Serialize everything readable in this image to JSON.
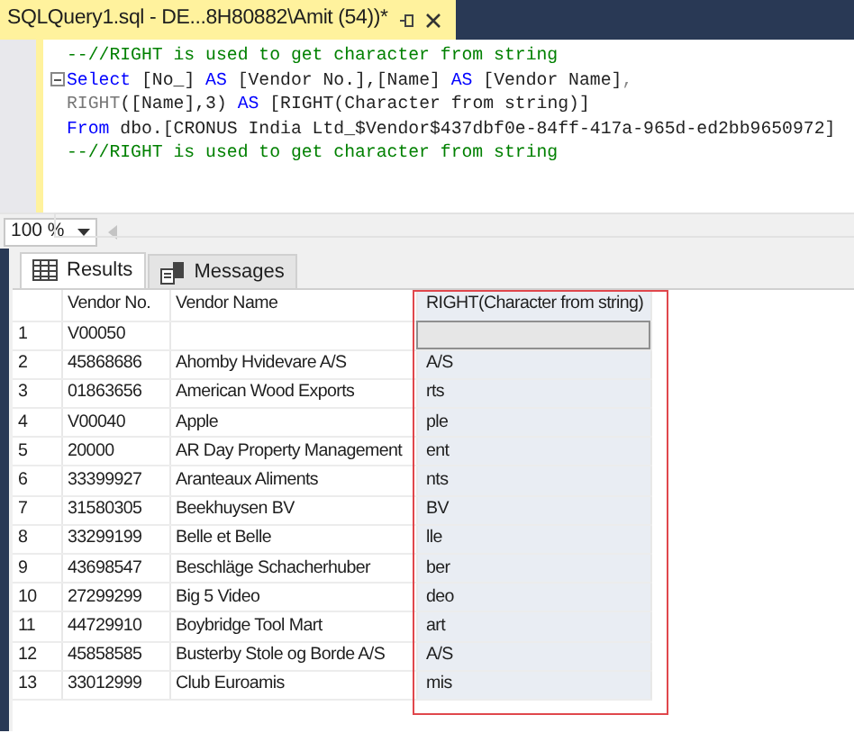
{
  "document_tab": {
    "title": "SQLQuery1.sql - DE...8H80882\\Amit (54))*",
    "selected": true
  },
  "editor": {
    "lines": [
      {
        "fold": false,
        "tokens": [
          {
            "kind": "comment",
            "text": "--//RIGHT is used to get character from string"
          }
        ]
      },
      {
        "fold": true,
        "tokens": [
          {
            "kind": "keyword",
            "text": "Select"
          },
          {
            "kind": "plain",
            "text": " [No_] "
          },
          {
            "kind": "keyword",
            "text": "AS"
          },
          {
            "kind": "plain",
            "text": " [Vendor No.],[Name] "
          },
          {
            "kind": "keyword",
            "text": "AS"
          },
          {
            "kind": "plain",
            "text": " [Vendor Name]"
          },
          {
            "kind": "operator",
            "text": ","
          }
        ]
      },
      {
        "fold": false,
        "tokens": [
          {
            "kind": "function",
            "text": "RIGHT"
          },
          {
            "kind": "plain",
            "text": "([Name],3) "
          },
          {
            "kind": "keyword",
            "text": "AS"
          },
          {
            "kind": "plain",
            "text": " [RIGHT(Character from string)]"
          }
        ]
      },
      {
        "fold": false,
        "tokens": [
          {
            "kind": "keyword",
            "text": "From"
          },
          {
            "kind": "plain",
            "text": " dbo.[CRONUS India Ltd_$Vendor$437dbf0e-84ff-417a-965d-ed2bb9650972]"
          }
        ]
      },
      {
        "fold": false,
        "tokens": [
          {
            "kind": "comment",
            "text": "--//RIGHT is used to get character from string"
          }
        ]
      }
    ]
  },
  "zoom": {
    "value": "100 %"
  },
  "result_tabs": [
    {
      "label": "Results",
      "selected": true
    },
    {
      "label": "Messages",
      "selected": false
    }
  ],
  "grid": {
    "columns": [
      {
        "label": "Vendor No.",
        "selected": false
      },
      {
        "label": "Vendor Name",
        "selected": false
      },
      {
        "label": "RIGHT(Character from string)",
        "selected": true
      }
    ],
    "rows": [
      {
        "number": "1",
        "focused": true,
        "cells": [
          "V00050",
          "",
          ""
        ]
      },
      {
        "number": "2",
        "focused": false,
        "cells": [
          "45868686",
          "Ahomby Hvidevare A/S",
          "A/S"
        ]
      },
      {
        "number": "3",
        "focused": false,
        "cells": [
          "01863656",
          "American Wood Exports",
          "rts"
        ]
      },
      {
        "number": "4",
        "focused": false,
        "cells": [
          "V00040",
          "Apple",
          "ple"
        ]
      },
      {
        "number": "5",
        "focused": false,
        "cells": [
          "20000",
          "AR Day Property Management",
          "ent"
        ]
      },
      {
        "number": "6",
        "focused": false,
        "cells": [
          "33399927",
          "Aranteaux Aliments",
          "nts"
        ]
      },
      {
        "number": "7",
        "focused": false,
        "cells": [
          "31580305",
          "Beekhuysen BV",
          " BV"
        ]
      },
      {
        "number": "8",
        "focused": false,
        "cells": [
          "33299199",
          "Belle et Belle",
          "lle"
        ]
      },
      {
        "number": "9",
        "focused": false,
        "cells": [
          "43698547",
          "Beschläge Schacherhuber",
          "ber"
        ]
      },
      {
        "number": "10",
        "focused": false,
        "cells": [
          "27299299",
          "Big 5 Video",
          "deo"
        ]
      },
      {
        "number": "11",
        "focused": false,
        "cells": [
          "44729910",
          "Boybridge Tool Mart",
          "art"
        ]
      },
      {
        "number": "12",
        "focused": false,
        "cells": [
          "45858585",
          "Busterby Stole og Borde A/S",
          "A/S"
        ]
      },
      {
        "number": "13",
        "focused": false,
        "cells": [
          "33012999",
          "Club Euroamis",
          "mis"
        ]
      }
    ]
  },
  "highlight": {
    "kind": "outline",
    "color": "#e0474c"
  }
}
